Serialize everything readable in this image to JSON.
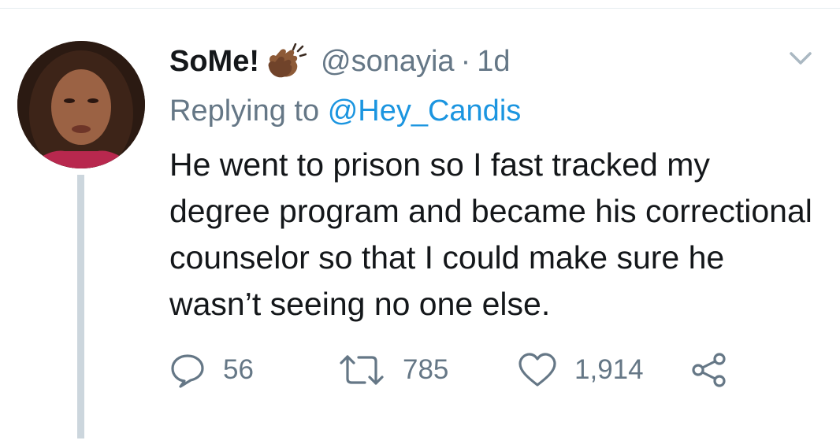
{
  "tweet": {
    "author_name": "SoMe!",
    "author_handle": "@sonayia",
    "separator": "·",
    "timestamp": "1d",
    "replying_prefix": "Replying to",
    "replying_to": "@Hey_Candis",
    "text": "He went to prison so I fast tracked my degree program and became his correctional counselor so that I could make sure he wasn’t seeing no one else.",
    "icons": {
      "author_emoji": "clapping-hands-emoji",
      "menu": "chevron-down-icon",
      "reply": "reply-icon",
      "retweet": "retweet-icon",
      "like": "heart-icon",
      "share": "share-icon"
    },
    "stats": {
      "replies": "56",
      "retweets": "785",
      "likes": "1,914"
    }
  },
  "colors": {
    "text": "#14171a",
    "secondary": "#657786",
    "link": "#1b95e0",
    "thread_line": "#ccd6dd"
  }
}
